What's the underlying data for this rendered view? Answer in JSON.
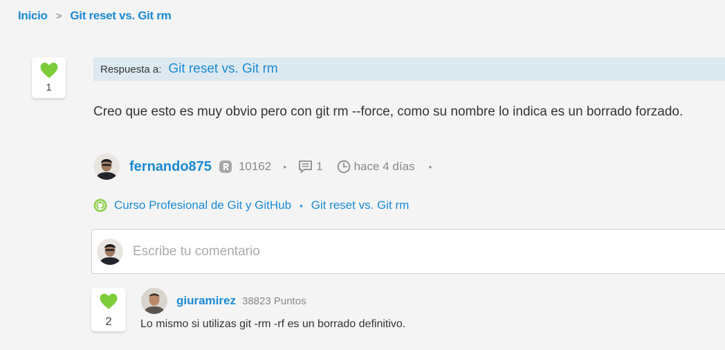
{
  "breadcrumb": {
    "home": "Inicio",
    "separator": ">",
    "current": "Git reset vs. Git rm"
  },
  "post": {
    "likes": "1",
    "reply_label": "Respuesta a:",
    "reply_title": "Git reset vs. Git rm",
    "body": "Creo que esto es muy obvio pero con git rm --force, como su nombre lo indica es un borrado forzado.",
    "author": "fernando875",
    "author_points": "10162",
    "comment_count": "1",
    "time_ago": "hace 4 días",
    "meta_separator": "•",
    "course": "Curso Profesional de Git y GitHub",
    "tag_separator": "•",
    "topic": "Git reset vs. Git rm"
  },
  "comment_input": {
    "placeholder": "Escribe tu comentario"
  },
  "reply": {
    "likes": "2",
    "author": "giuramirez",
    "points": "38823 Puntos",
    "body": "Lo mismo si utilizas git -rm -rf es un borrado definitivo."
  },
  "icons": {
    "heart": "heart-icon",
    "rank": "rank-badge-icon",
    "comment": "comment-icon",
    "clock": "clock-icon",
    "github": "github-icon"
  },
  "colors": {
    "link": "#1a8ad4",
    "heart": "#7dcc3a",
    "banner": "#dde9f0",
    "background": "#f4f4f4"
  }
}
